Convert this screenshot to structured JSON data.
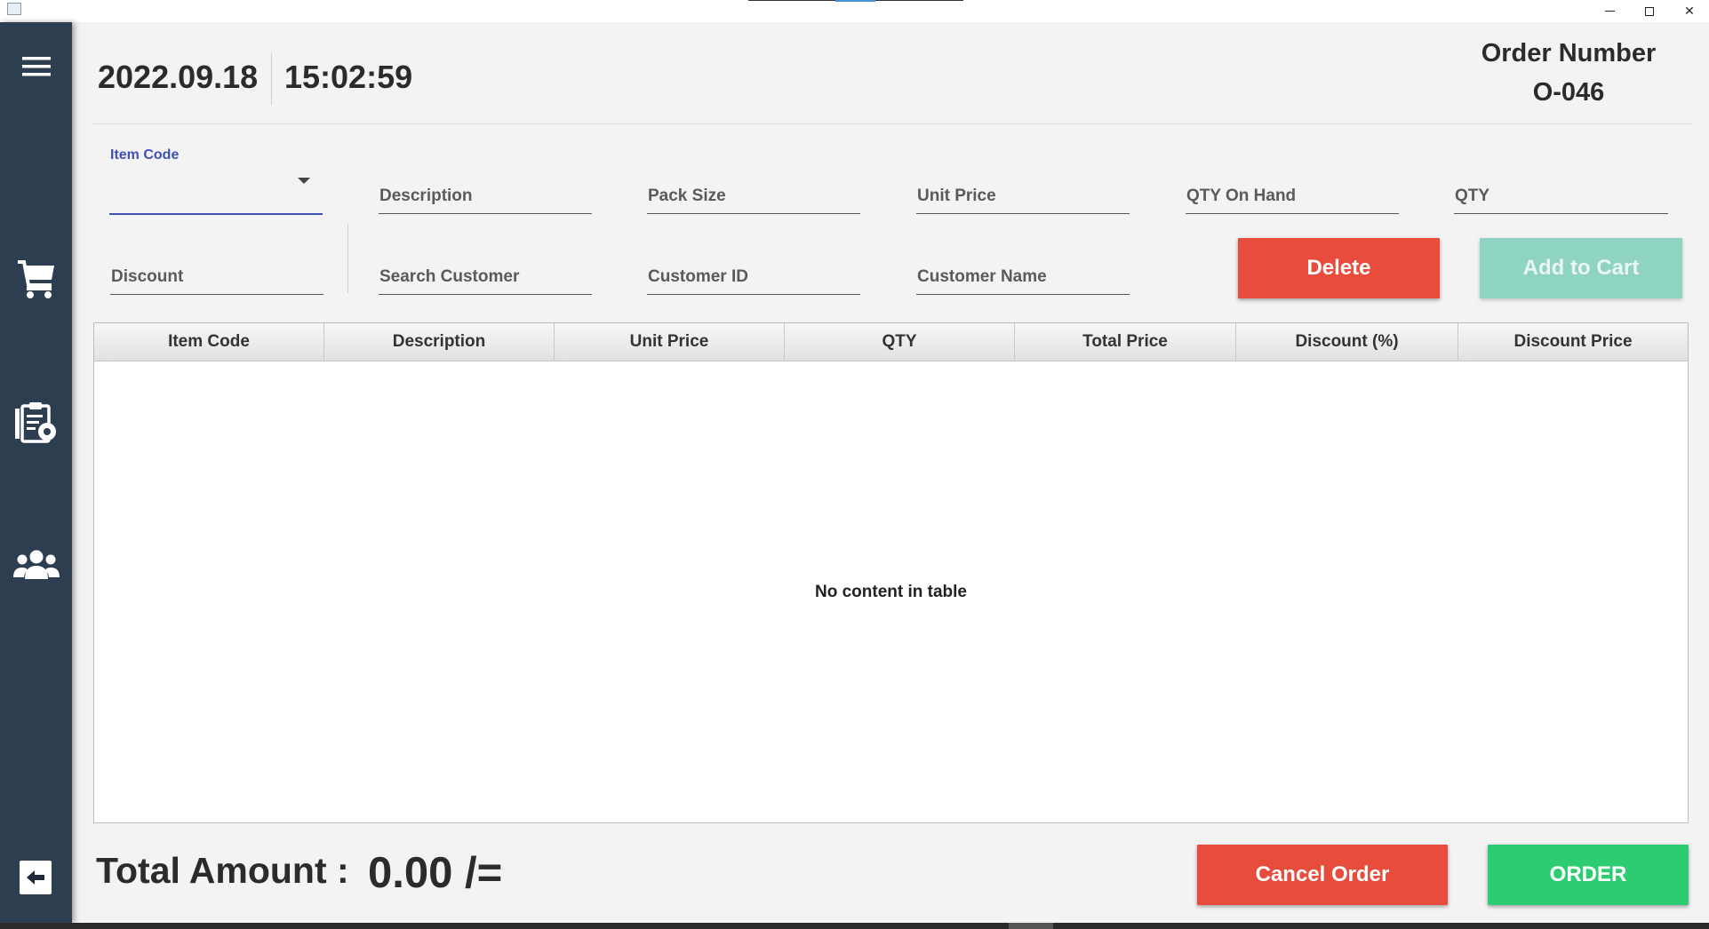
{
  "window": {
    "minimize_glyph": "",
    "close_glyph": "✕"
  },
  "header": {
    "date": "2022.09.18",
    "time": "15:02:59",
    "order_number_label": "Order Number",
    "order_number_value": "O-046"
  },
  "form": {
    "item_code": {
      "label": "Item Code",
      "value": ""
    },
    "description": {
      "label": "Description",
      "value": ""
    },
    "pack_size": {
      "label": "Pack Size",
      "value": ""
    },
    "unit_price": {
      "label": "Unit Price",
      "value": ""
    },
    "qty_on_hand": {
      "label": "QTY On Hand",
      "value": ""
    },
    "qty": {
      "label": "QTY",
      "value": ""
    },
    "discount": {
      "label": "Discount",
      "value": ""
    },
    "search_customer": {
      "label": "Search Customer",
      "value": ""
    },
    "customer_id": {
      "label": "Customer ID",
      "value": ""
    },
    "customer_name": {
      "label": "Customer Name",
      "value": ""
    }
  },
  "buttons": {
    "delete": "Delete",
    "add_to_cart": "Add to Cart",
    "cancel_order": "Cancel Order",
    "order": "ORDER"
  },
  "table": {
    "columns": [
      "Item Code",
      "Description",
      "Unit Price",
      "QTY",
      "Total Price",
      "Discount (%)",
      "Discount Price"
    ],
    "rows": [],
    "empty_message": "No content in table"
  },
  "footer": {
    "total_label": "Total Amount :",
    "total_value": "0.00 /="
  },
  "sidebar": {
    "items": [
      "menu-icon",
      "cart-icon",
      "clipboard-settings-icon",
      "people-icon",
      "back-arrow-icon"
    ]
  },
  "colors": {
    "sidebar": "#2c3e50",
    "danger": "#e74c3c",
    "success": "#2ecc71",
    "disabled_teal": "#8fd3c2",
    "focus": "#3f51b5"
  }
}
